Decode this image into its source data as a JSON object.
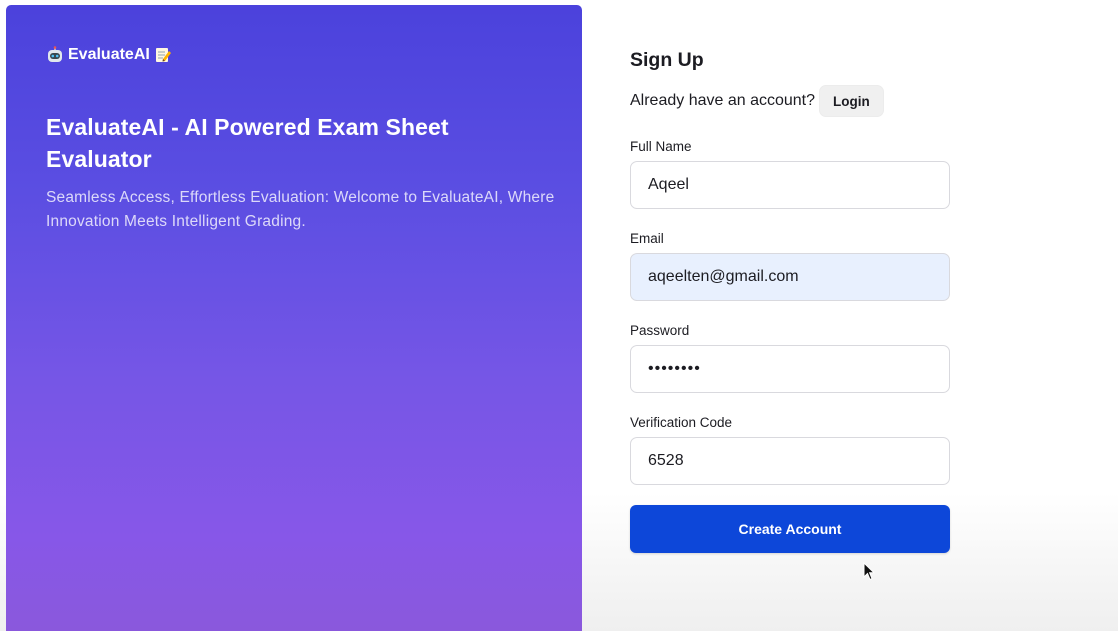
{
  "hero": {
    "brand_name": "EvaluateAI",
    "brand_icons": [
      "robot-icon",
      "memo-icon"
    ],
    "title": "EvaluateAI - AI Powered Exam Sheet Evaluator",
    "subtitle": "Seamless Access, Effortless Evaluation: Welcome to EvaluateAI, Where Innovation Meets Intelligent Grading."
  },
  "form": {
    "title": "Sign Up",
    "login_prompt": "Already have an account?",
    "login_label": "Login",
    "full_name": {
      "label": "Full Name",
      "value": "Aqeel"
    },
    "email": {
      "label": "Email",
      "value": "aqeelten@gmail.com"
    },
    "password": {
      "label": "Password",
      "value": "••••••••"
    },
    "verification_code": {
      "label": "Verification Code",
      "value": "6528"
    },
    "submit_label": "Create Account"
  },
  "colors": {
    "hero_gradient_top": "#4b42dc",
    "hero_gradient_bottom": "#8a58dc",
    "primary_button": "#0d47d9",
    "autofill_background": "#e8f0fe"
  }
}
